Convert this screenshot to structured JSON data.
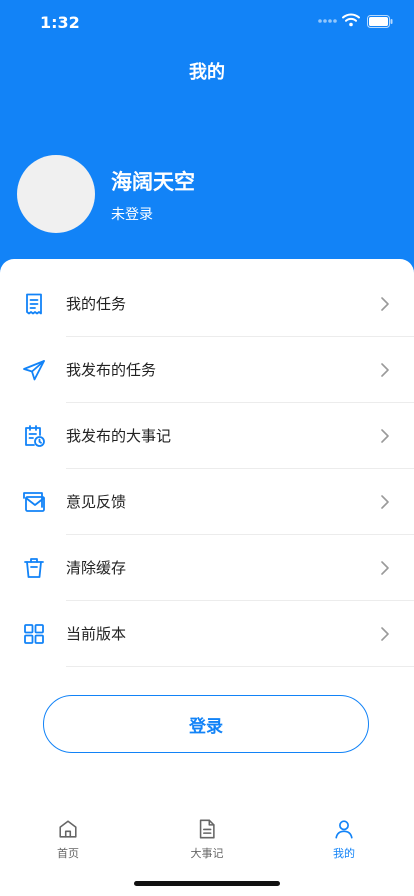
{
  "status_bar": {
    "time": "1:32"
  },
  "header": {
    "title": "我的",
    "user_name": "海阔天空",
    "login_status": "未登录"
  },
  "menu": [
    {
      "label": "我的任务",
      "icon": "receipt-icon"
    },
    {
      "label": "我发布的任务",
      "icon": "paper-plane-icon"
    },
    {
      "label": "我发布的大事记",
      "icon": "calendar-clock-icon"
    },
    {
      "label": "意见反馈",
      "icon": "envelope-icon"
    },
    {
      "label": "清除缓存",
      "icon": "trash-icon"
    },
    {
      "label": "当前版本",
      "icon": "grid-icon"
    }
  ],
  "login_button": "登录",
  "tab_bar": [
    {
      "label": "首页",
      "icon": "home-icon",
      "active": false
    },
    {
      "label": "大事记",
      "icon": "document-icon",
      "active": false
    },
    {
      "label": "我的",
      "icon": "user-icon",
      "active": true
    }
  ],
  "colors": {
    "brand": "#1283f7",
    "card_bg": "#ffffff",
    "avatar_bg": "#f0f0f0"
  }
}
